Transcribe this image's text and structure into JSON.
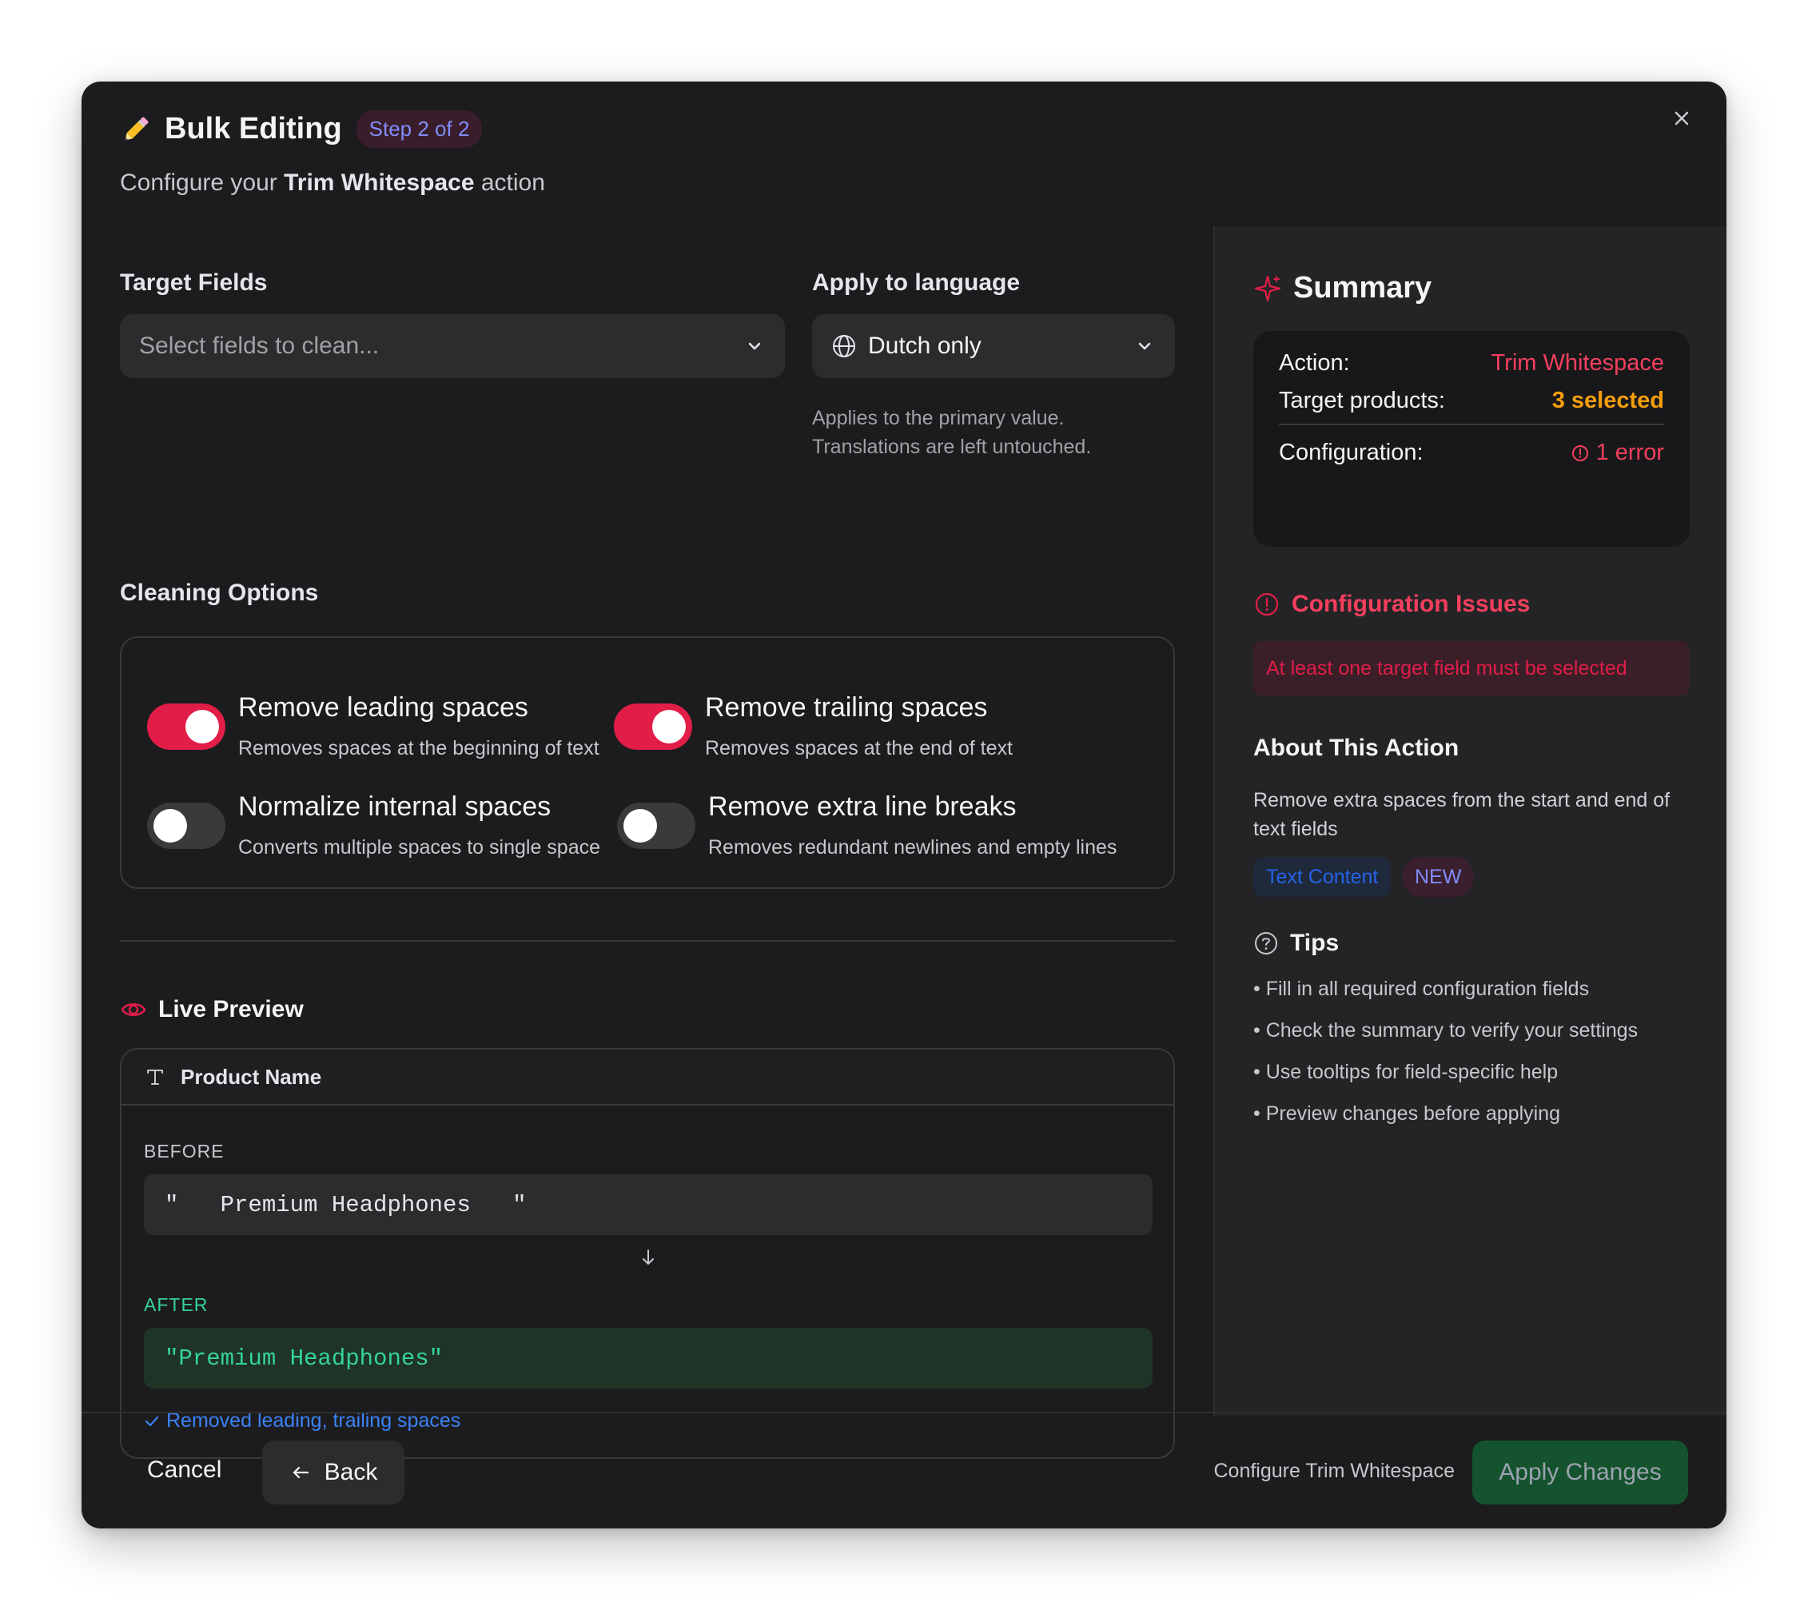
{
  "header": {
    "title": "Bulk Editing",
    "step_badge": "Step 2 of 2",
    "subtitle_prefix": "Configure your ",
    "subtitle_action": "Trim Whitespace",
    "subtitle_suffix": " action"
  },
  "target_fields": {
    "label": "Target Fields",
    "placeholder": "Select fields to clean..."
  },
  "language": {
    "label": "Apply to language",
    "value": "Dutch only",
    "hint_line1": "Applies to the primary value.",
    "hint_line2": "Translations are left untouched."
  },
  "cleaning": {
    "label": "Cleaning Options",
    "options": [
      {
        "title": "Remove leading spaces",
        "desc": "Removes spaces at the beginning of text",
        "enabled": true
      },
      {
        "title": "Remove trailing spaces",
        "desc": "Removes spaces at the end of text",
        "enabled": true
      },
      {
        "title": "Normalize internal spaces",
        "desc": "Converts multiple spaces to single space",
        "enabled": false
      },
      {
        "title": "Remove extra line breaks",
        "desc": "Removes redundant newlines and empty lines",
        "enabled": false
      }
    ]
  },
  "preview": {
    "label": "Live Preview",
    "field_name": "Product Name",
    "before_label": "BEFORE",
    "before_value": "\"   Premium Headphones   \"",
    "after_label": "AFTER",
    "after_value": "\"Premium Headphones\"",
    "change_note": "Removed leading, trailing spaces"
  },
  "summary": {
    "title": "Summary",
    "action_label": "Action:",
    "action_value": "Trim Whitespace",
    "targets_label": "Target products:",
    "targets_value": "3 selected",
    "config_label": "Configuration:",
    "config_value": "1 error"
  },
  "issues": {
    "title": "Configuration Issues",
    "message": "At least one target field must be selected"
  },
  "about": {
    "title": "About This Action",
    "description": "Remove extra spaces from the start and end of text fields",
    "tag_category": "Text Content",
    "tag_new": "NEW"
  },
  "tips": {
    "title": "Tips",
    "items": [
      "Fill in all required configuration fields",
      "Check the summary to verify your settings",
      "Use tooltips for field-specific help",
      "Preview changes before applying"
    ]
  },
  "footer": {
    "cancel": "Cancel",
    "back": "Back",
    "note": "Configure Trim Whitespace",
    "apply": "Apply Changes"
  },
  "colors": {
    "accent": "#e11d48",
    "success": "#34d399",
    "warning": "#f59e0b",
    "background": "#1c1c1e"
  }
}
